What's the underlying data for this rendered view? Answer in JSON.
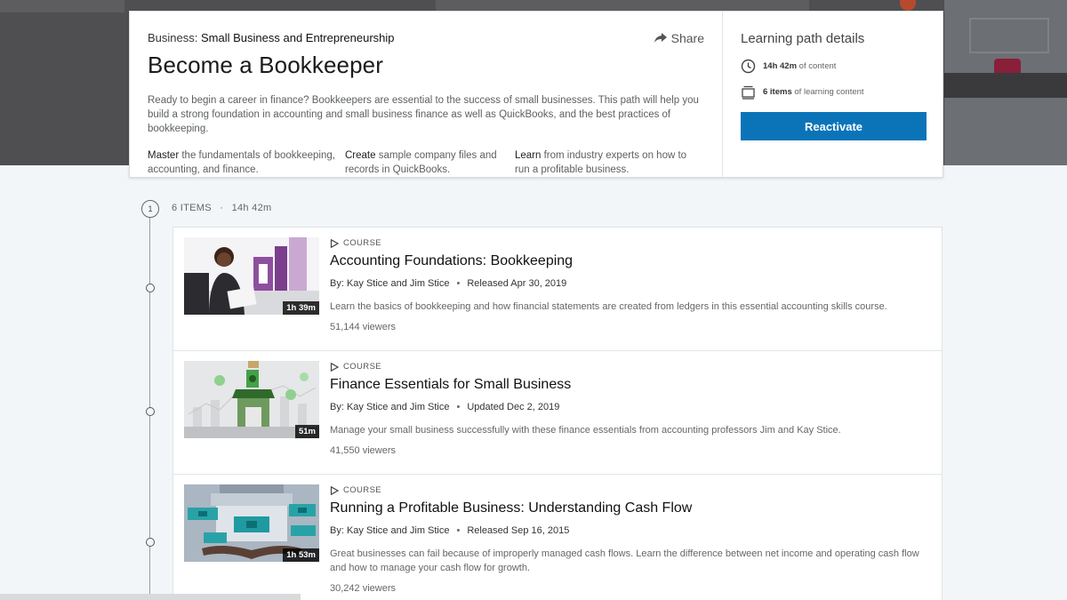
{
  "header": {
    "breadcrumb_prefix": "Business:",
    "breadcrumb_value": "Small Business and Entrepreneurship",
    "share_label": "Share",
    "title": "Become a Bookkeeper",
    "description": "Ready to begin a career in finance? Bookkeepers are essential to the success of small businesses. This path will help you build a strong foundation in accounting and small business finance as well as QuickBooks, and the best practices of bookkeeping.",
    "goals": [
      {
        "verb": "Master",
        "rest": " the fundamentals of bookkeeping, accounting, and finance."
      },
      {
        "verb": "Create",
        "rest": " sample company files and records in QuickBooks."
      },
      {
        "verb": "Learn",
        "rest": " from industry experts on how to run a profitable business."
      }
    ]
  },
  "details": {
    "title": "Learning path details",
    "duration_value": "14h 42m",
    "duration_suffix": "of content",
    "items_value": "6 items",
    "items_suffix": "of learning content",
    "button_label": "Reactivate"
  },
  "timeline": {
    "step_number": "1",
    "items_label": "6 ITEMS",
    "dot": "·",
    "total_duration": "14h 42m"
  },
  "courses": [
    {
      "kind": "COURSE",
      "title": "Accounting Foundations: Bookkeeping",
      "authors": "By: Kay Stice and Jim Stice",
      "date": "Released Apr 30, 2019",
      "summary": "Learn the basics of bookkeeping and how financial statements are created from ledgers in this essential accounting skills course.",
      "viewers": "51,144 viewers",
      "duration": "1h 39m"
    },
    {
      "kind": "COURSE",
      "title": "Finance Essentials for Small Business",
      "authors": "By: Kay Stice and Jim Stice",
      "date": "Updated Dec 2, 2019",
      "summary": "Manage your small business successfully with these finance essentials from accounting professors Jim and Kay Stice.",
      "viewers": "41,550 viewers",
      "duration": "51m"
    },
    {
      "kind": "COURSE",
      "title": "Running a Profitable Business: Understanding Cash Flow",
      "authors": "By: Kay Stice and Jim Stice",
      "date": "Released Sep 16, 2015",
      "summary": "Great businesses can fail because of improperly managed cash flows. Learn the difference between net income and operating cash flow and how to manage your cash flow for growth.",
      "viewers": "30,242 viewers",
      "duration": "1h 53m"
    }
  ],
  "colors": {
    "accent": "#0b74b9",
    "page_bg": "#f3f6f8",
    "hero_bg": "#4f4f52"
  },
  "icons": {
    "share": "share-arrow-icon",
    "clock": "clock-icon",
    "items": "stack-icon",
    "play": "play-icon"
  }
}
